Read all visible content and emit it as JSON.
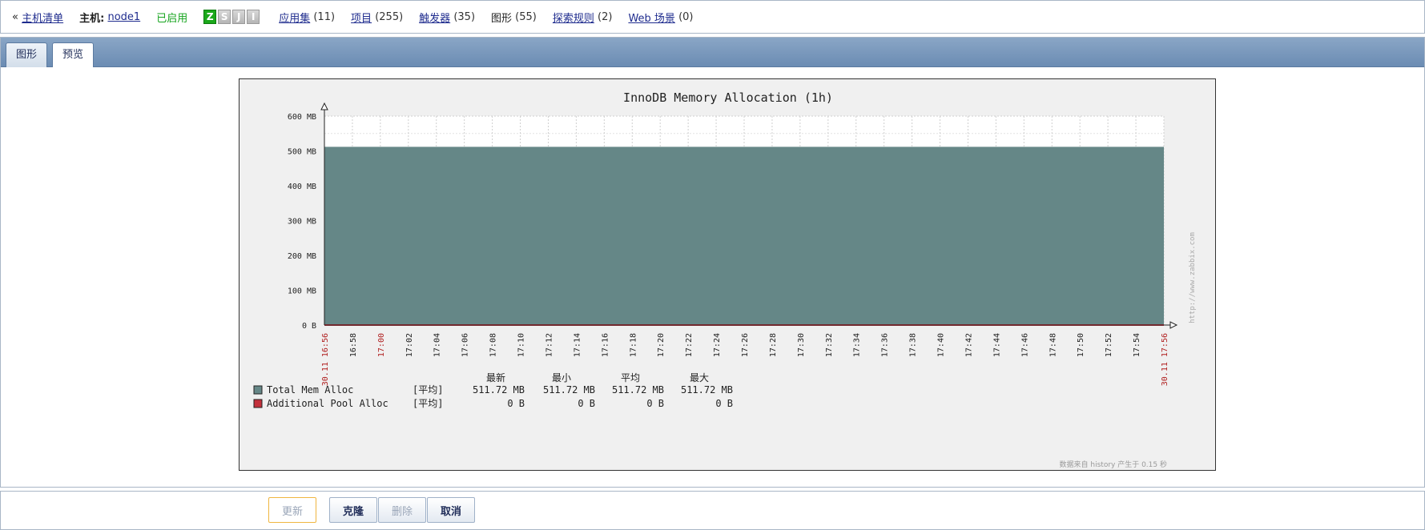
{
  "topbar": {
    "back_prefix": "«",
    "host_list": "主机清单",
    "host_label": "主机:",
    "host_name": "node1",
    "status": "已启用",
    "availability": [
      "Z",
      "S",
      "J",
      "I"
    ],
    "applications": "应用集",
    "applications_count": "(11)",
    "items": "项目",
    "items_count": "(255)",
    "triggers": "触发器",
    "triggers_count": "(35)",
    "graphs": "图形",
    "graphs_count": "(55)",
    "discovery": "探索规则",
    "discovery_count": "(2)",
    "web": "Web 场景",
    "web_count": "(0)"
  },
  "tabs": [
    "图形",
    "预览"
  ],
  "buttons": {
    "update": "更新",
    "clone": "克隆",
    "delete": "删除",
    "cancel": "取消"
  },
  "colors": {
    "series_total": "#658787",
    "series_additional": "#c3303b",
    "time_red": "#b02020"
  },
  "chart_data": {
    "type": "area",
    "title": "InnoDB Memory Allocation (1h)",
    "y_ticks": [
      "0 B",
      "100 MB",
      "200 MB",
      "300 MB",
      "400 MB",
      "500 MB",
      "600 MB"
    ],
    "ylim": [
      0,
      600
    ],
    "y_unit": "MB",
    "x_labels": [
      "30.11 16:56",
      "16:58",
      "17:00",
      "17:02",
      "17:04",
      "17:06",
      "17:08",
      "17:10",
      "17:12",
      "17:14",
      "17:16",
      "17:18",
      "17:20",
      "17:22",
      "17:24",
      "17:26",
      "17:28",
      "17:30",
      "17:32",
      "17:34",
      "17:36",
      "17:38",
      "17:40",
      "17:42",
      "17:44",
      "17:46",
      "17:48",
      "17:50",
      "17:52",
      "17:54",
      "30.11 17:56"
    ],
    "x_label_red": [
      true,
      false,
      true,
      false,
      false,
      false,
      false,
      false,
      false,
      false,
      false,
      false,
      false,
      false,
      false,
      false,
      false,
      false,
      false,
      false,
      false,
      false,
      false,
      false,
      false,
      false,
      false,
      false,
      false,
      false,
      true
    ],
    "grid": true,
    "series": [
      {
        "name": "Total Mem Alloc",
        "value": 511.72,
        "func": "[平均]",
        "last": "511.72 MB",
        "min": "511.72 MB",
        "avg": "511.72 MB",
        "max": "511.72 MB"
      },
      {
        "name": "Additional Pool Alloc",
        "value": 0,
        "func": "[平均]",
        "last": "0 B",
        "min": "0 B",
        "avg": "0 B",
        "max": "0 B"
      }
    ],
    "legend_headers": [
      "最新",
      "最小",
      "平均",
      "最大"
    ],
    "footer": "数据来自 history  产生于 0.15 秒",
    "watermark": "http://www.zabbix.com"
  }
}
